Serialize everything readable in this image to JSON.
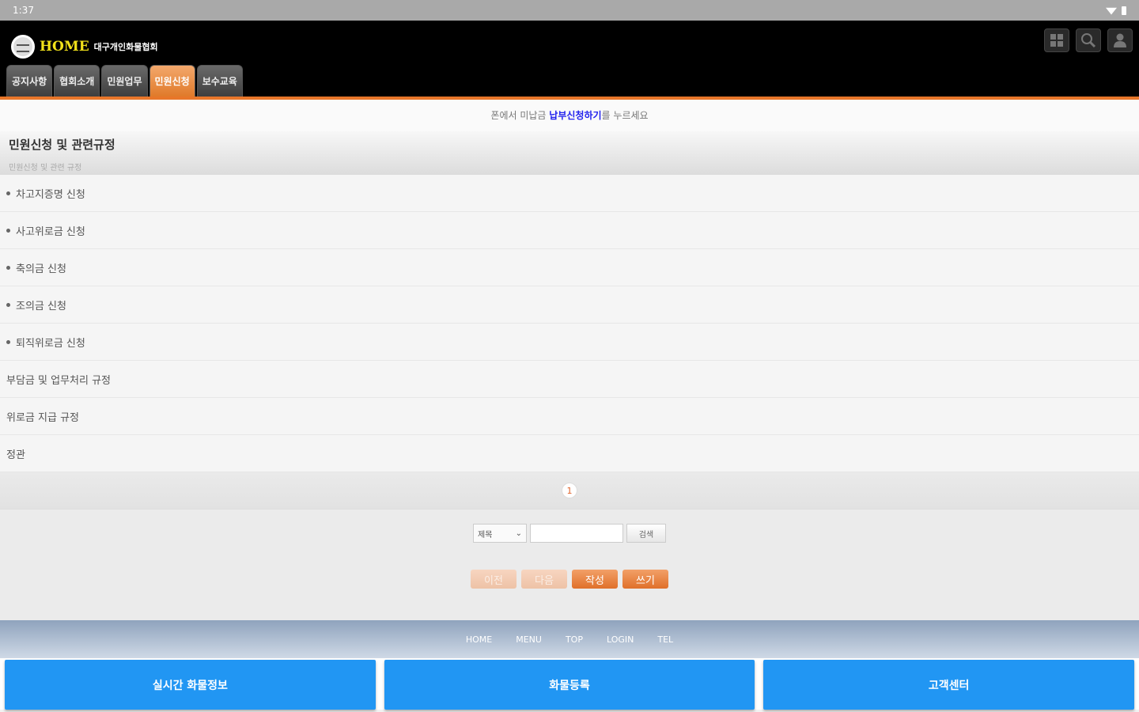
{
  "status": {
    "time": "1:37"
  },
  "header": {
    "logo_home": "HOME",
    "logo_sub": "대구개인화물협회",
    "tabs": [
      "공지사항",
      "협회소개",
      "민원업무",
      "민원신청",
      "보수교육"
    ],
    "active_tab": "민원신청"
  },
  "notice": {
    "prefix": "폰에서 미납금 ",
    "link": "납부신청하기",
    "suffix": "를 누르세요"
  },
  "section": {
    "title": "민원신청 및 관련규정",
    "subtitle": "민원신청 및 관련 규정"
  },
  "items": [
    {
      "label": "차고지증명 신청",
      "bullet": true
    },
    {
      "label": "사고위로금 신청",
      "bullet": true
    },
    {
      "label": "축의금 신청",
      "bullet": true
    },
    {
      "label": "조의금 신청",
      "bullet": true
    },
    {
      "label": "퇴직위로금 신청",
      "bullet": true
    },
    {
      "label": "부담금 및 업무처리 규정",
      "bullet": false
    },
    {
      "label": "위로금 지급 규정",
      "bullet": false
    },
    {
      "label": "정관",
      "bullet": false
    }
  ],
  "pagination": {
    "current": "1"
  },
  "search": {
    "select_value": "제목",
    "input_value": "",
    "button": "검색"
  },
  "buttons": {
    "prev": "이전",
    "next": "다음",
    "write": "작성",
    "list": "쓰기"
  },
  "footer_nav": [
    "HOME",
    "MENU",
    "TOP",
    "LOGIN",
    "TEL"
  ],
  "bottom_buttons": [
    "실시간 화물정보",
    "화물등록",
    "고객센터"
  ],
  "colors": {
    "accent": "#e8762a",
    "bottom_button": "#2196f3",
    "logo_home": "#f2e21a"
  }
}
